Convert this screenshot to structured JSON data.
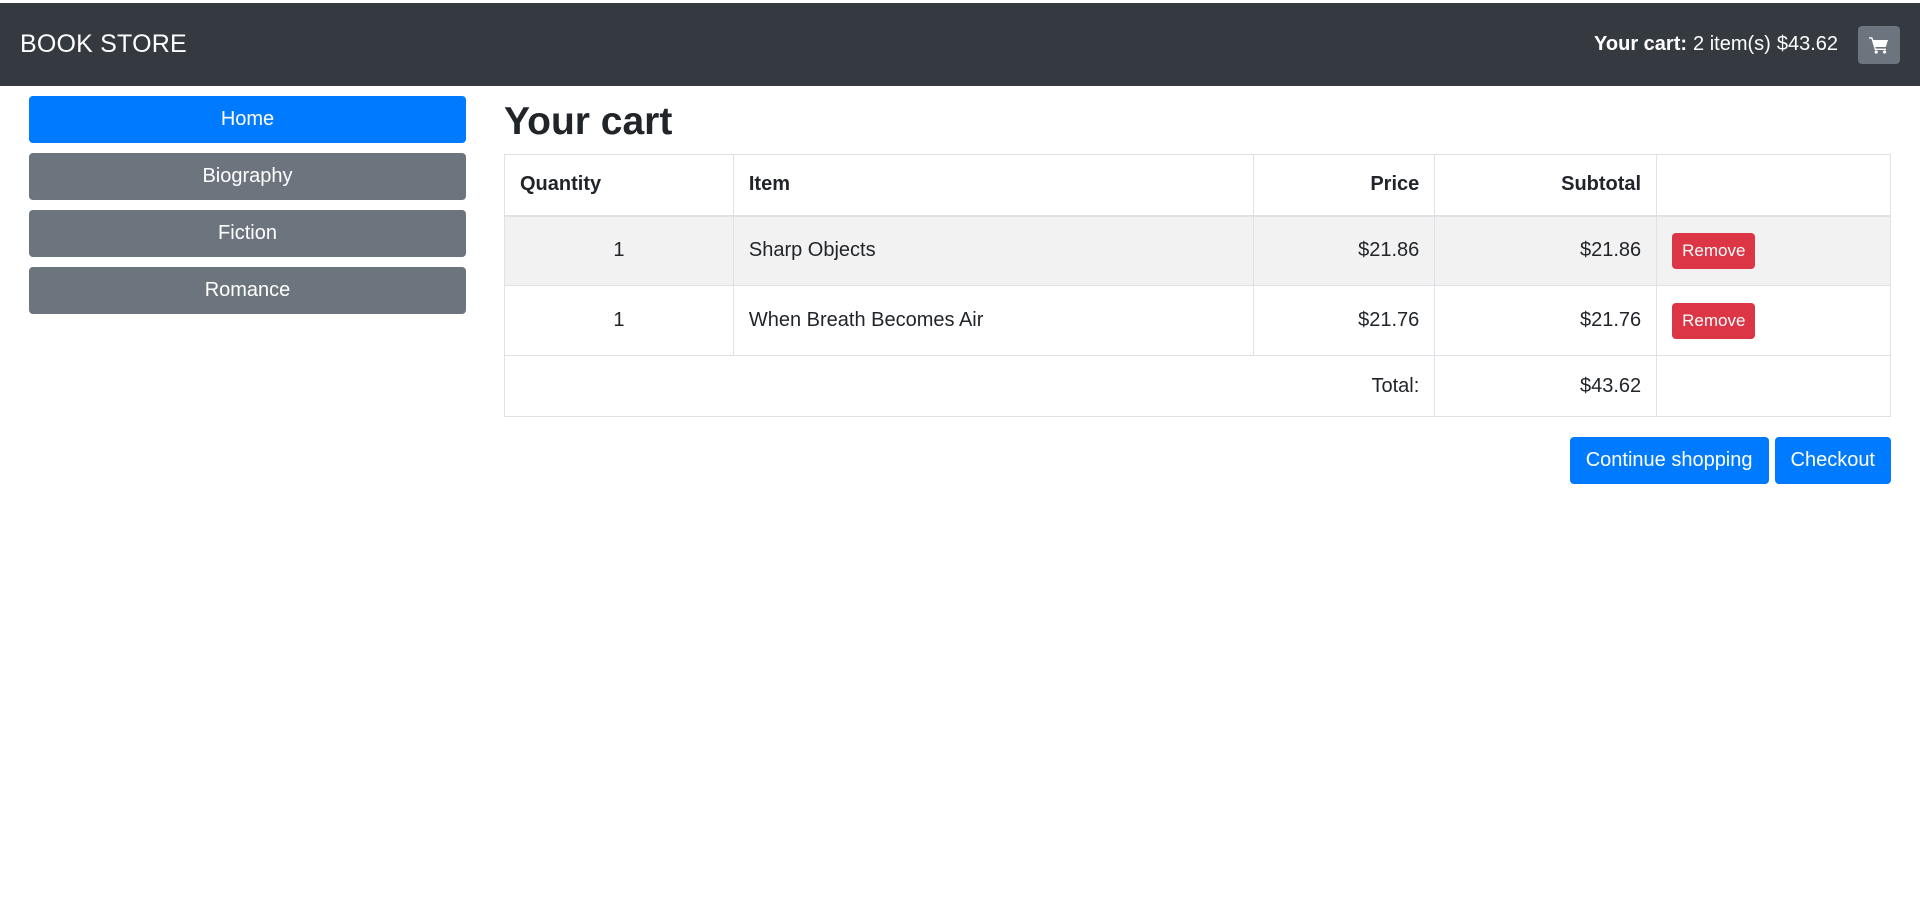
{
  "navbar": {
    "brand": "BOOK STORE",
    "cart_label": "Your cart:",
    "cart_items": "2 item(s)",
    "cart_total": "$43.62",
    "cart_icon": "shopping-cart-icon"
  },
  "sidebar": {
    "items": [
      {
        "label": "Home",
        "active": true
      },
      {
        "label": "Biography",
        "active": false
      },
      {
        "label": "Fiction",
        "active": false
      },
      {
        "label": "Romance",
        "active": false
      }
    ]
  },
  "main": {
    "title": "Your cart",
    "table": {
      "headers": {
        "quantity": "Quantity",
        "item": "Item",
        "price": "Price",
        "subtotal": "Subtotal"
      },
      "rows": [
        {
          "quantity": "1",
          "item": "Sharp Objects",
          "price": "$21.86",
          "subtotal": "$21.86",
          "action": "Remove"
        },
        {
          "quantity": "1",
          "item": "When Breath Becomes Air",
          "price": "$21.76",
          "subtotal": "$21.76",
          "action": "Remove"
        }
      ],
      "total_label": "Total:",
      "total_value": "$43.62"
    },
    "actions": {
      "continue_label": "Continue shopping",
      "checkout_label": "Checkout"
    }
  },
  "colors": {
    "navbar_bg": "#343a40",
    "primary": "#007bff",
    "secondary": "#6c757d",
    "danger": "#dc3545"
  }
}
